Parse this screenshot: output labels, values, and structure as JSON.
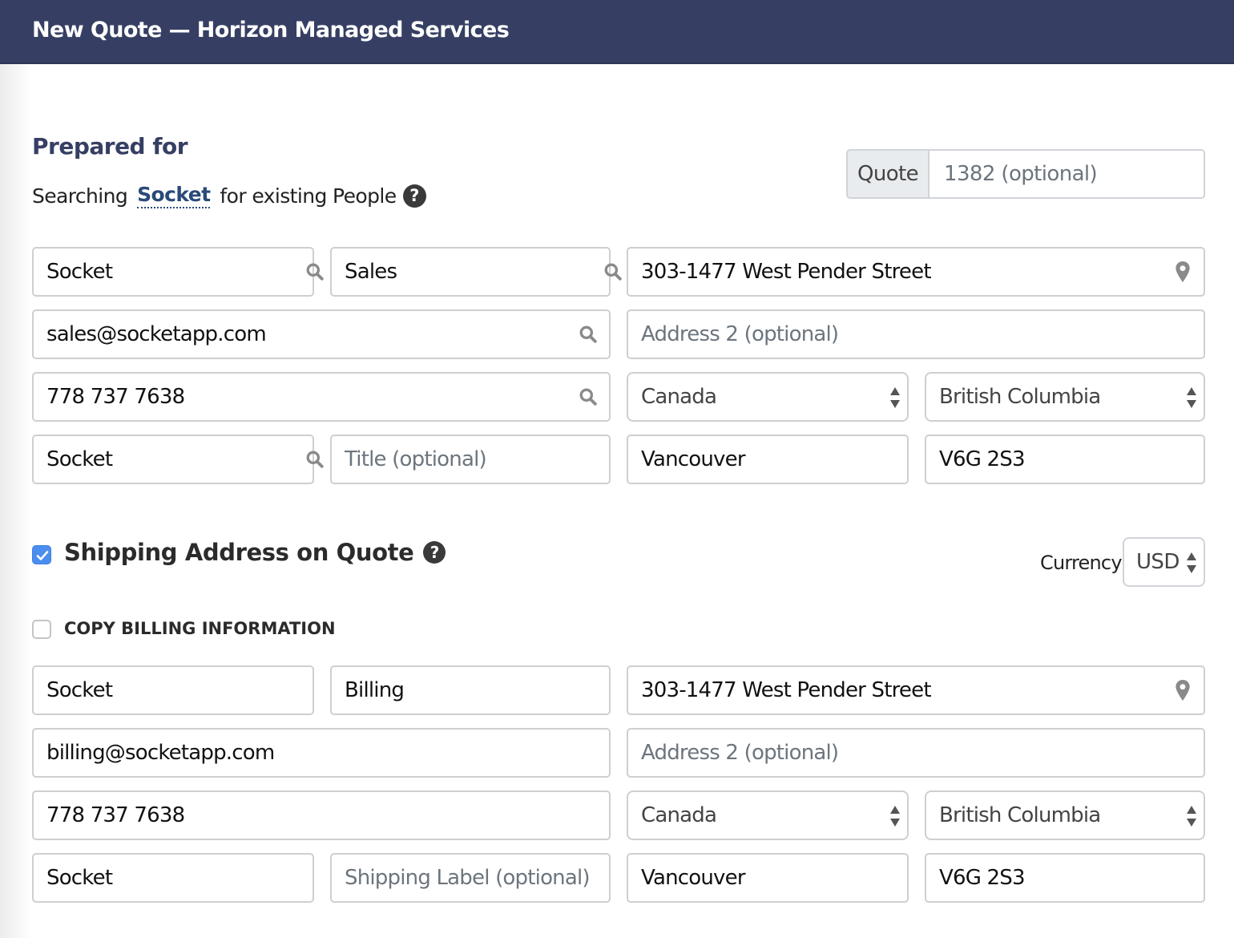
{
  "header": {
    "title": "New Quote — Horizon Managed Services"
  },
  "prepared_for": {
    "title": "Prepared for",
    "search_prefix": "Searching",
    "search_source": "Socket",
    "search_suffix": "for existing People",
    "help_icon": "question-circle-icon"
  },
  "quote": {
    "addon_label": "Quote",
    "value": "",
    "placeholder": "1382 (optional)"
  },
  "billing": {
    "company": {
      "value": "Socket",
      "icon": "search-icon"
    },
    "contact": {
      "value": "Sales",
      "icon": "search-icon"
    },
    "email": {
      "value": "sales@socketapp.com",
      "icon": "search-icon"
    },
    "phone": {
      "value": "778 737 7638",
      "icon": "search-icon"
    },
    "name": {
      "value": "Socket",
      "icon": "search-icon"
    },
    "title": {
      "value": "",
      "placeholder": "Title (optional)"
    },
    "address1": {
      "value": "303-1477 West Pender Street",
      "icon": "map-marker-icon"
    },
    "address2": {
      "value": "",
      "placeholder": "Address 2 (optional)"
    },
    "country": {
      "selected": "Canada"
    },
    "province": {
      "selected": "British Columbia"
    },
    "city": {
      "value": "Vancouver"
    },
    "postal": {
      "value": "V6G 2S3"
    }
  },
  "shipping_toggle": {
    "label": "Shipping Address on Quote",
    "checked": true,
    "help_icon": "question-circle-icon"
  },
  "currency": {
    "label": "Currency",
    "selected": "USD"
  },
  "copy_billing": {
    "label": "COPY BILLING INFORMATION",
    "checked": false
  },
  "shipping": {
    "company": {
      "value": "Socket"
    },
    "contact": {
      "value": "Billing"
    },
    "email": {
      "value": "billing@socketapp.com"
    },
    "phone": {
      "value": "778 737 7638"
    },
    "name": {
      "value": "Socket"
    },
    "label": {
      "value": "",
      "placeholder": "Shipping Label (optional)"
    },
    "address1": {
      "value": "303-1477 West Pender Street",
      "icon": "map-marker-icon"
    },
    "address2": {
      "value": "",
      "placeholder": "Address 2 (optional)"
    },
    "country": {
      "selected": "Canada"
    },
    "province": {
      "selected": "British Columbia"
    },
    "city": {
      "value": "Vancouver"
    },
    "postal": {
      "value": "V6G 2S3"
    }
  },
  "colors": {
    "header_bg": "#363f63",
    "heading": "#363f63",
    "link": "#2a4a78",
    "checkbox_on": "#4b8ef0",
    "placeholder": "#6c757d",
    "border": "#cfcfcf"
  }
}
